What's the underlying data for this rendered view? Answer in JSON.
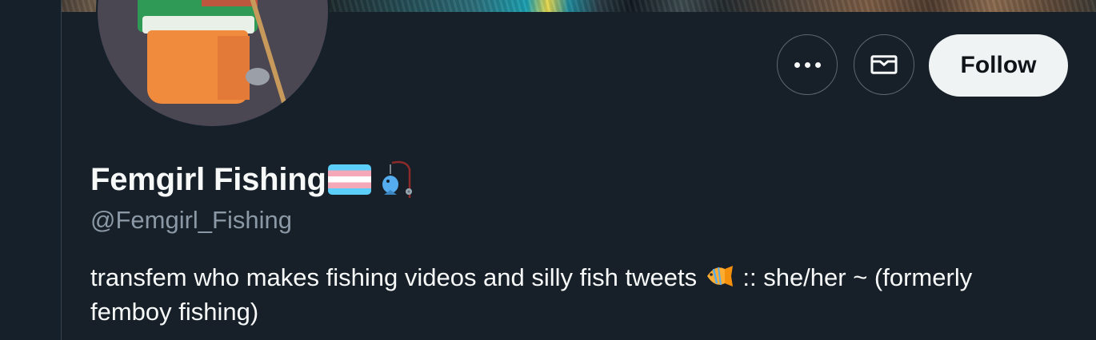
{
  "profile": {
    "display_name": "Femgirl Fishing",
    "name_emojis": [
      "transgender-flag-icon",
      "fishing-pole-fish-icon"
    ],
    "handle": "@Femgirl_Fishing",
    "bio_part1": "transfem who makes fishing videos and silly fish tweets",
    "bio_emoji": "tropical-fish-icon",
    "bio_part2": ":: she/her ~ (formerly femboy fishing)"
  },
  "actions": {
    "more_icon": "more-horizontal-icon",
    "message_icon": "envelope-icon",
    "follow_label": "Follow"
  },
  "colors": {
    "background": "#15202b",
    "text_primary": "#f7f9f9",
    "text_secondary": "#8b98a5",
    "follow_button_bg": "#eff3f4",
    "border": "#5b6773"
  }
}
